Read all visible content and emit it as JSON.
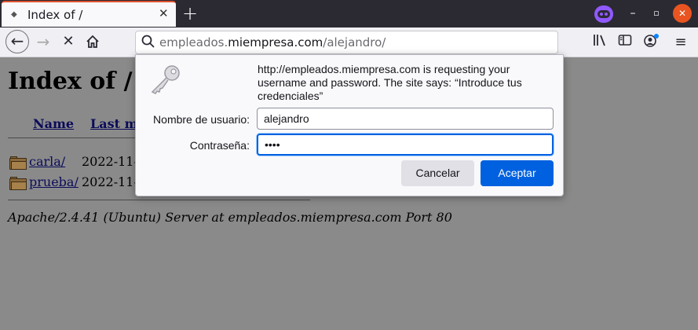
{
  "tab": {
    "title": "Index of /"
  },
  "browser": {
    "url_prefix": "empleados.",
    "url_host": "miempresa.com",
    "url_path": "/alejandro/"
  },
  "page": {
    "heading": "Index of /",
    "columns": [
      "Name",
      "Last m"
    ],
    "rows": [
      {
        "name": "carla/",
        "date": "2022-11-"
      },
      {
        "name": "prueba/",
        "date": "2022-11-"
      }
    ],
    "footer": "Apache/2.4.41 (Ubuntu) Server at empleados.miempresa.com Port 80"
  },
  "dialog": {
    "message": "http://empleados.miempresa.com is requesting your username and password. The site says: “Introduce tus credenciales”",
    "username_label": "Nombre de usuario:",
    "username_value": "alejandro",
    "password_label": "Contraseña:",
    "password_value": "••••",
    "cancel_label": "Cancelar",
    "ok_label": "Aceptar"
  },
  "colors": {
    "accent": "#0061e0",
    "tabstrip": "#2b2a33",
    "private": "#9059ff",
    "window_close": "#e95420"
  }
}
